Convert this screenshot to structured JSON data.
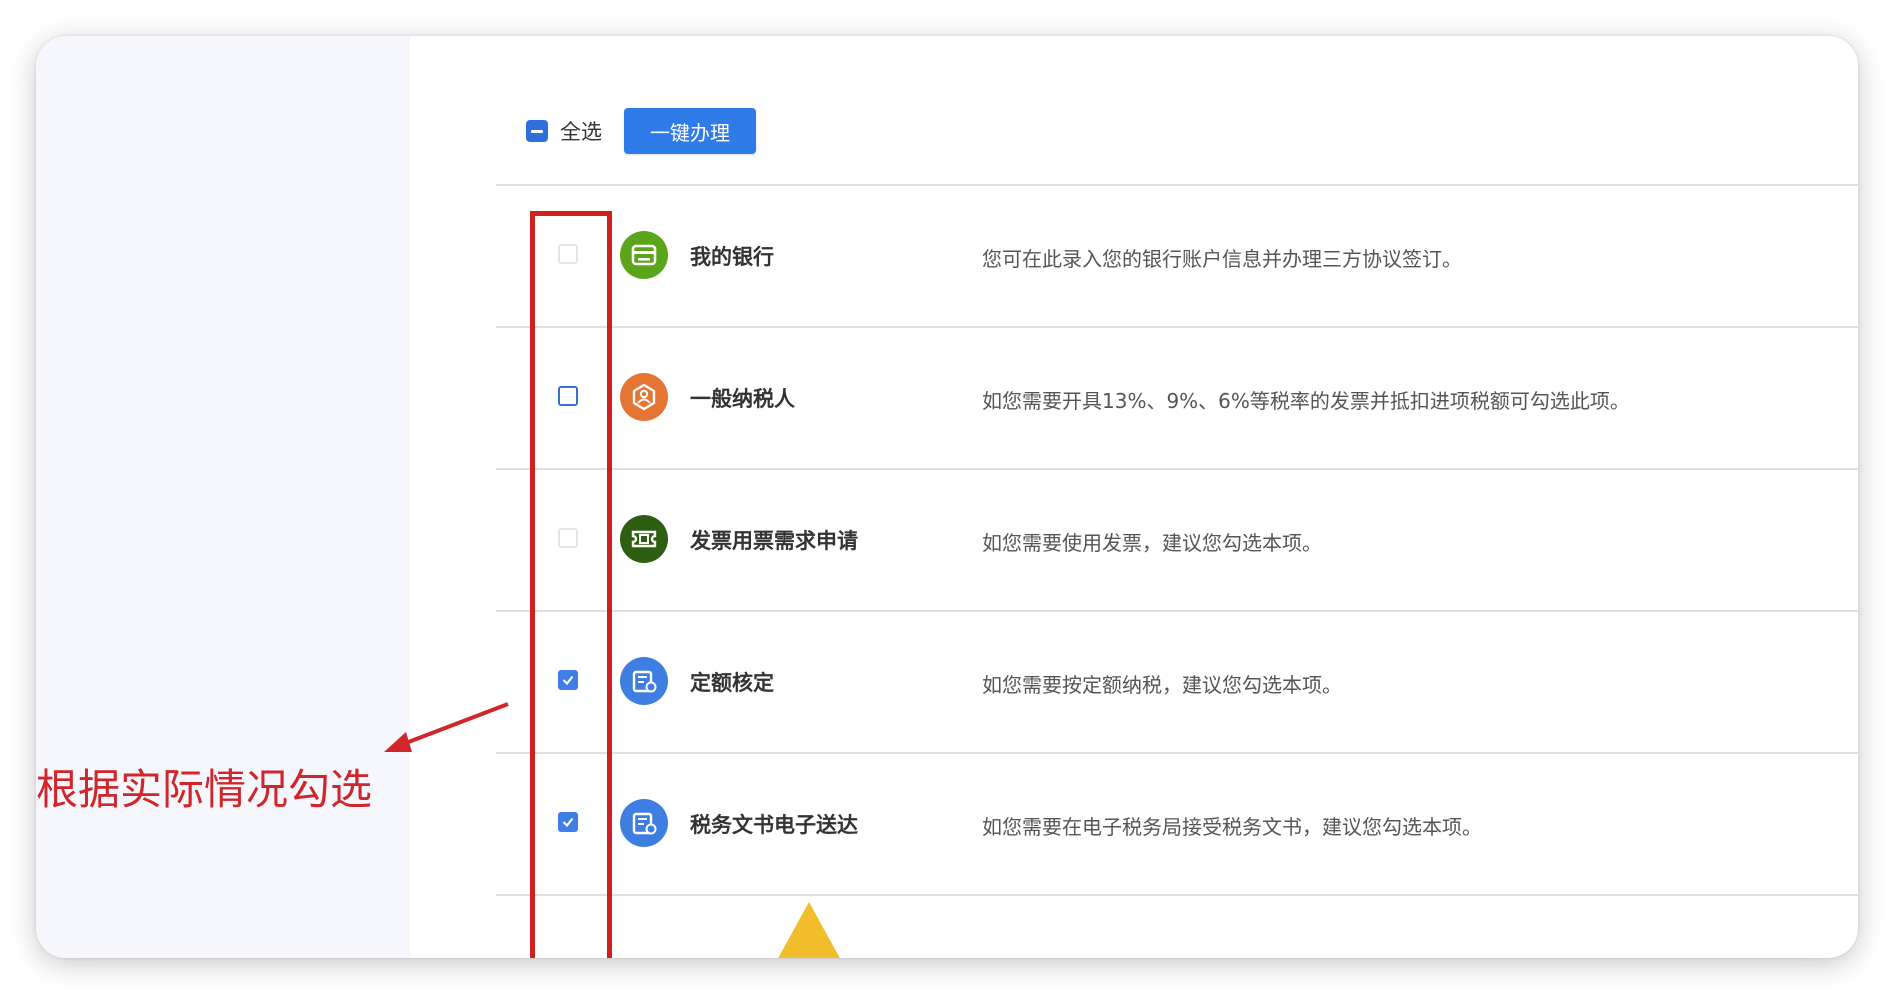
{
  "toolbar": {
    "select_all_label": "全选",
    "one_click_button": "一键办理"
  },
  "rows": [
    {
      "title": "我的银行",
      "description": "您可在此录入您的银行账户信息并办理三方协议签订。",
      "checkbox_state": "unchecked-disabled",
      "icon": "bank-card-icon",
      "icon_color": "#5aa51a"
    },
    {
      "title": "一般纳税人",
      "description": "如您需要开具13%、9%、6%等税率的发票并抵扣进项税额可勾选此项。",
      "checkbox_state": "unchecked",
      "icon": "taxpayer-icon",
      "icon_color": "#e57532"
    },
    {
      "title": "发票用票需求申请",
      "description": "如您需要使用发票，建议您勾选本项。",
      "checkbox_state": "unchecked-disabled",
      "icon": "invoice-ticket-icon",
      "icon_color": "#2e5e12"
    },
    {
      "title": "定额核定",
      "description": "如您需要按定额纳税，建议您勾选本项。",
      "checkbox_state": "checked",
      "icon": "quota-document-icon",
      "icon_color": "#3d7ee0"
    },
    {
      "title": "税务文书电子送达",
      "description": "如您需要在电子税务局接受税务文书，建议您勾选本项。",
      "checkbox_state": "checked",
      "icon": "electronic-document-icon",
      "icon_color": "#3d7ee0"
    }
  ],
  "annotation": {
    "text": "根据实际情况勾选",
    "color": "#d0262b"
  },
  "colors": {
    "primary": "#2f7be8",
    "highlight_box": "#d01f1f"
  }
}
